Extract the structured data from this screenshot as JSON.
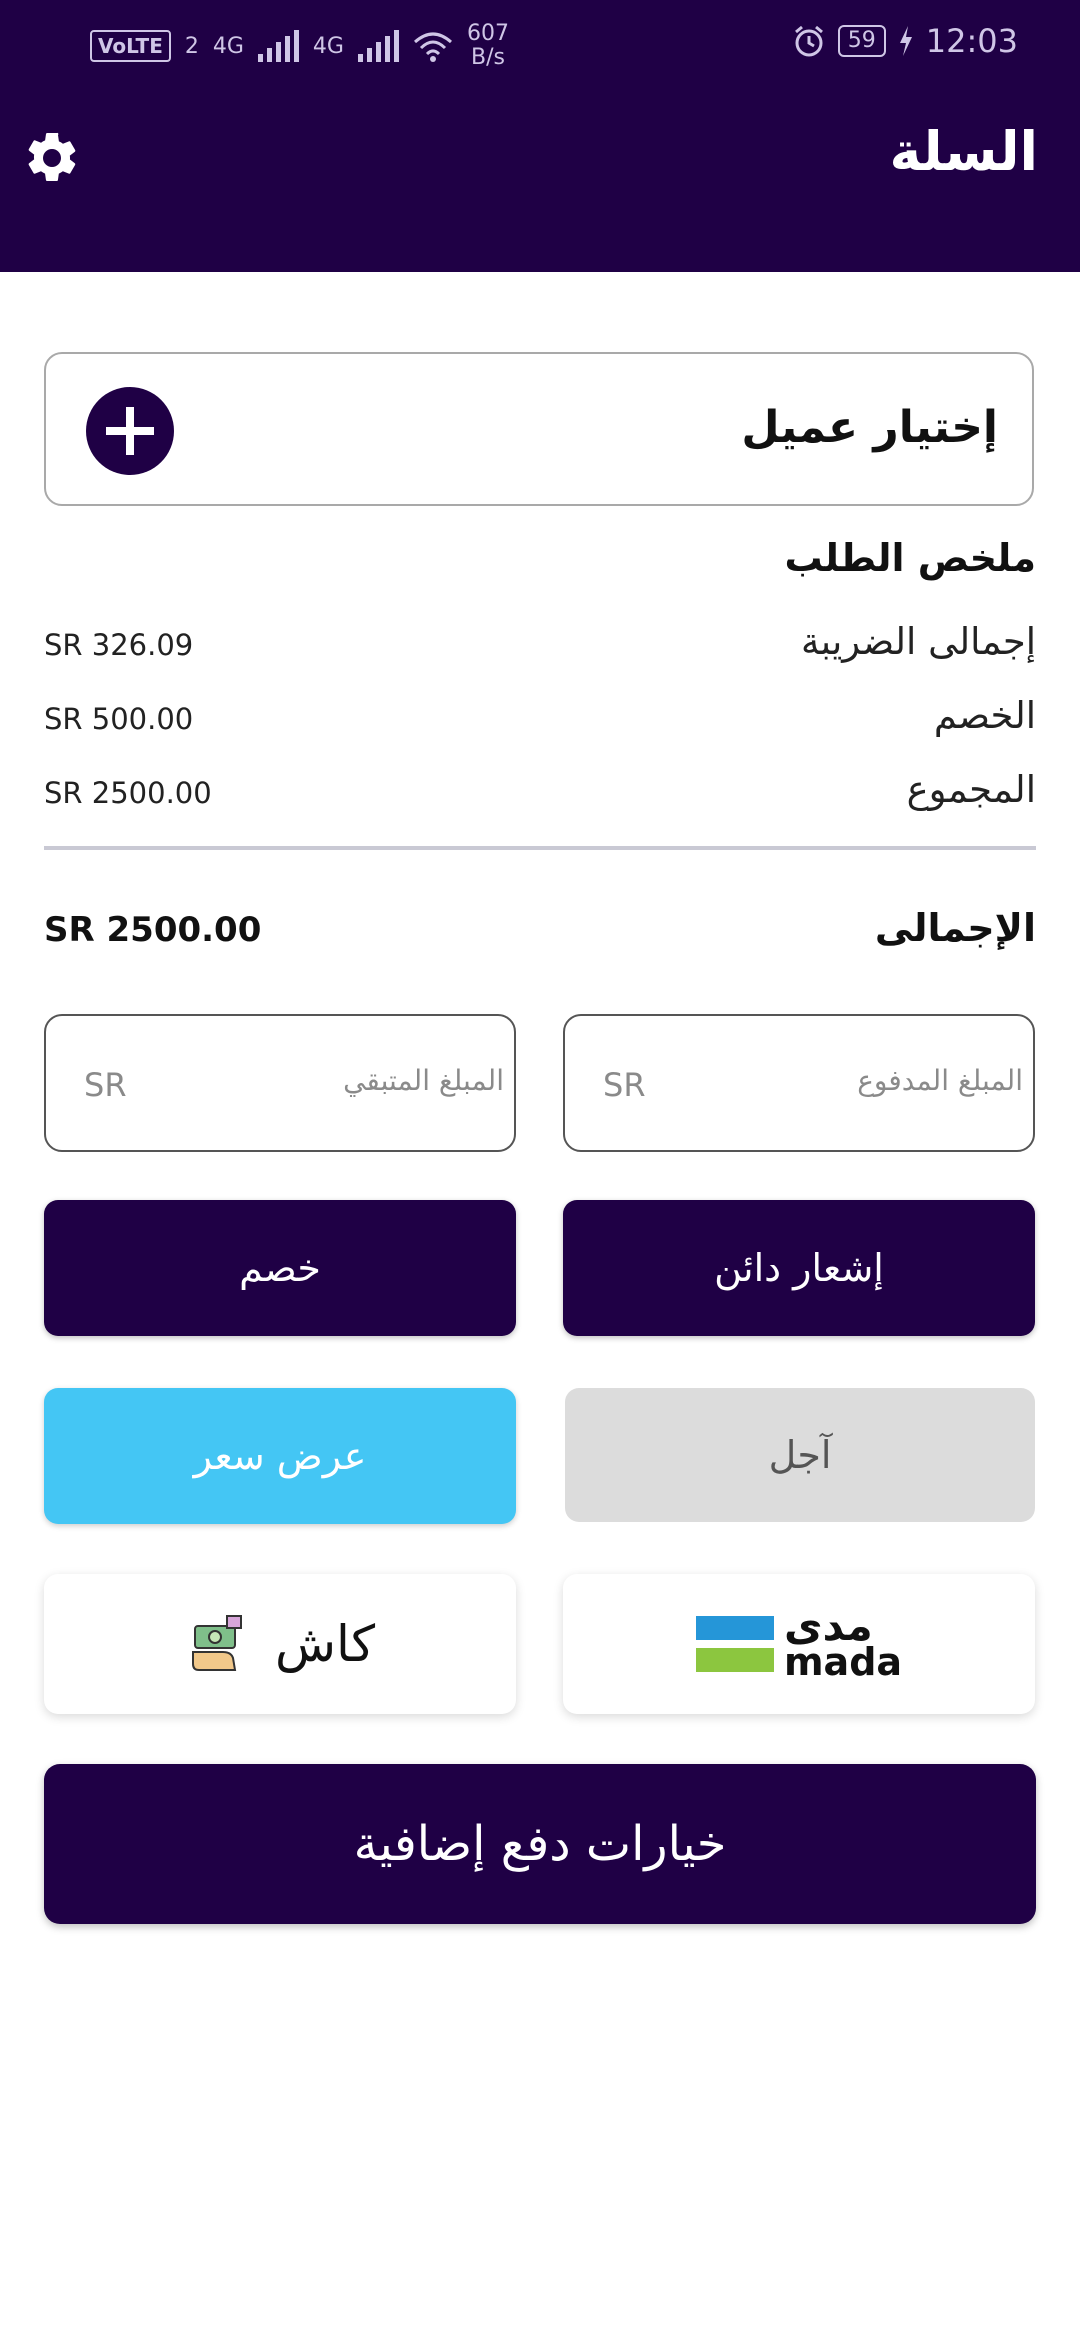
{
  "status": {
    "volte": "VoLTE",
    "sim": "2",
    "net1": "4G",
    "net2": "4G",
    "speed_value": "607",
    "speed_unit": "B/s",
    "battery": "59",
    "time": "12:03"
  },
  "header": {
    "title": "السلة"
  },
  "customer": {
    "label": "إختيار عميل"
  },
  "summary": {
    "title": "ملخص الطلب",
    "rows": [
      {
        "label": "إجمالى الضريبة",
        "value": "SR 326.09"
      },
      {
        "label": "الخصم",
        "value": "SR 500.00"
      },
      {
        "label": "المجموع",
        "value": "SR 2500.00"
      }
    ],
    "total_label": "الإجمالى",
    "total_value": "SR 2500.00"
  },
  "fields": {
    "paid_placeholder": "المبلغ المدفوع",
    "remaining_placeholder": "المبلغ المتبقي",
    "currency": "SR"
  },
  "buttons": {
    "discount": "خصم",
    "credit_note": "إشعار دائن",
    "quote": "عرض سعر",
    "deferred": "آجل",
    "cash": "كاش",
    "mada_ar": "مدى",
    "mada_en": "mada",
    "more_payments": "خيارات دفع إضافية"
  },
  "colors": {
    "primary": "#1f0045",
    "cyan": "#44c6f4",
    "mada_blue": "#2596d8",
    "mada_green": "#8cc63f"
  }
}
